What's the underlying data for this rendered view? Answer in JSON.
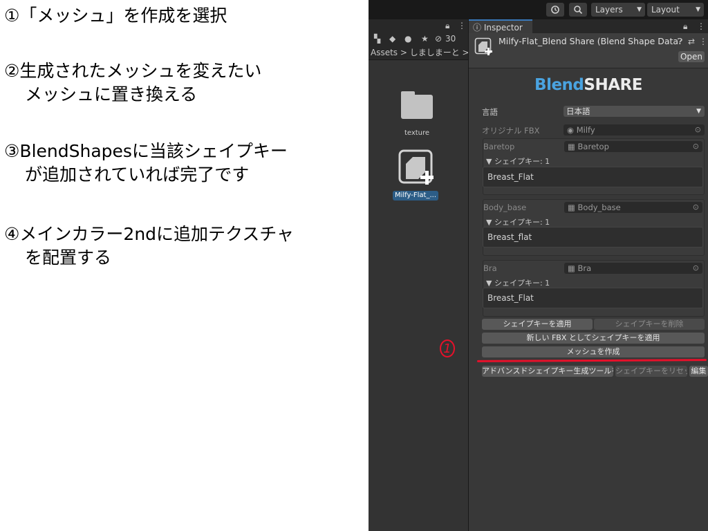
{
  "instructions": {
    "step1": "①「メッシュ」を作成を選択",
    "step2_line1": "②生成されたメッシュを変えたい",
    "step2_line2": "メッシュに置き換える",
    "step3_line1": "③BlendShapesに当該シェイプキー",
    "step3_line2": "が追加されていれば完了です",
    "step4_line1": "④メインカラー2ndに追加テクスチャ",
    "step4_line2": "を配置する"
  },
  "toolbar": {
    "layers_label": "Layers",
    "layout_label": "Layout"
  },
  "project": {
    "hidden_count": "30",
    "breadcrumb": "Assets > しましまーと > 追加",
    "items": [
      {
        "label": "texture",
        "icon": "folder-icon"
      },
      {
        "label": "Milfy-Flat_...",
        "icon": "blendshare-asset-icon"
      }
    ]
  },
  "inspector": {
    "tab_label": "Inspector",
    "title": "Milfy-Flat_Blend Share (Blend Shape Data",
    "open_label": "Open",
    "logo_part1": "Blend",
    "logo_part2": "SHARE",
    "language_label": "言語",
    "language_value": "日本語",
    "original_fbx_label": "オリジナル FBX",
    "original_fbx_value": "Milfy",
    "groups": [
      {
        "name": "Baretop",
        "mesh": "Baretop",
        "shapekey_header": "▼ シェイプキー: 1",
        "shape": "Breast_Flat"
      },
      {
        "name": "Body_base",
        "mesh": "Body_base",
        "shapekey_header": "▼ シェイプキー: 1",
        "shape": "Breast_flat"
      },
      {
        "name": "Bra",
        "mesh": "Bra",
        "shapekey_header": "▼ シェイプキー: 1",
        "shape": "Breast_Flat"
      }
    ],
    "buttons": {
      "apply_shapekey": "シェイプキーを適用",
      "delete_shapekey": "シェイプキーを削除",
      "apply_as_new_fbx": "新しい FBX としてシェイプキーを適用",
      "create_mesh": "メッシュを作成",
      "open_advanced_tool": "アドバンスドシェイプキー生成ツールを開く",
      "reset_shapekey": "シェイプキーをリセット",
      "edit": "編集"
    }
  },
  "annotation": {
    "mark": "1",
    "color": "#e8102a"
  }
}
